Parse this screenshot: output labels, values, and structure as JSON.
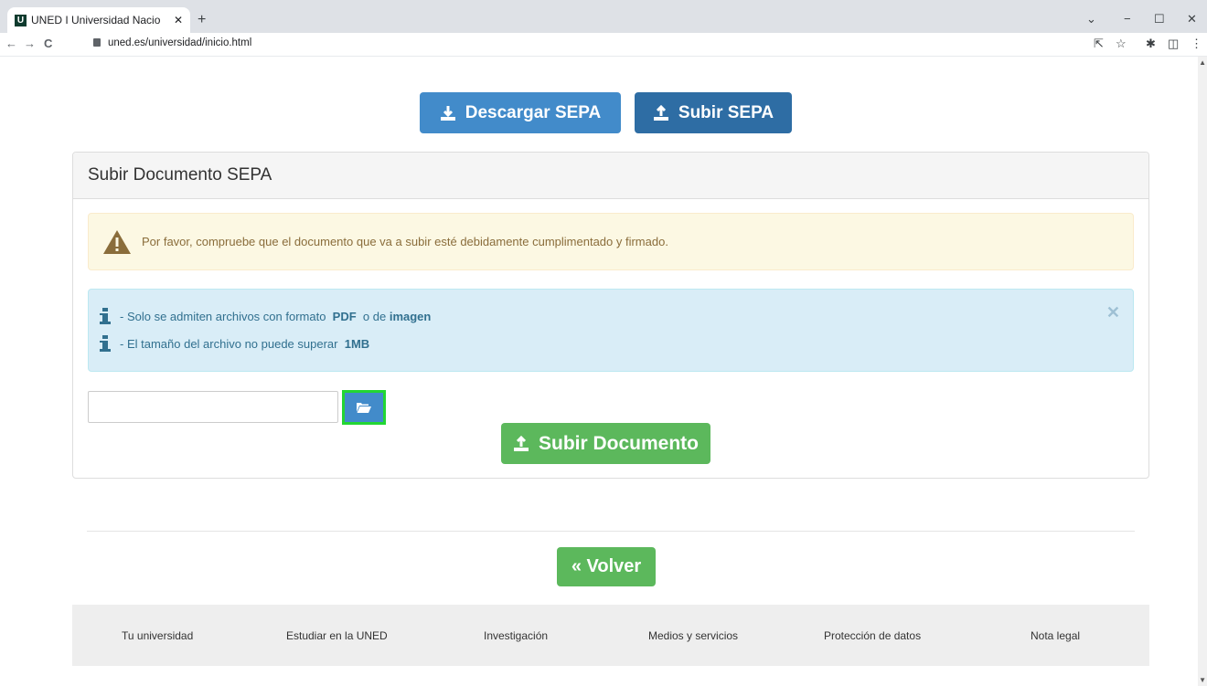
{
  "browser": {
    "tab_title": "UNED I Universidad Nacio",
    "favicon_letter": "U",
    "url": "uned.es/universidad/inicio.html",
    "new_tab": "+",
    "tab_close": "✕",
    "back": "←",
    "forward": "→",
    "reload": "C",
    "win_chevron": "⌄",
    "win_min": "−",
    "win_max": "☐",
    "win_close": "✕",
    "share_icon": "⇱",
    "star_icon": "☆",
    "ext_icon": "✱",
    "sidebar_icon": "◫",
    "menu_icon": "⋮"
  },
  "actions": {
    "descargar_label": "Descargar SEPA",
    "subir_label": "Subir SEPA"
  },
  "panel": {
    "heading": "Subir Documento SEPA",
    "warning_text": "Por favor, compruebe que el documento que va a subir esté debidamente cumplimentado y firmado.",
    "info": {
      "line1_prefix": "- Solo se admiten archivos con formato",
      "line1_pdf": "PDF",
      "line1_mid": "o de",
      "line1_img": "imagen",
      "line2_prefix": "- El tamaño del archivo no puede superar",
      "line2_size": "1MB",
      "close": "✕"
    },
    "file_value": "",
    "submit_label": "Subir Documento"
  },
  "back_label": "« Volver",
  "footer": {
    "links": [
      "Tu universidad",
      "Estudiar en la UNED",
      "Investigación",
      "Medios y servicios",
      "Protección de datos",
      "Nota legal"
    ]
  },
  "colors": {
    "primary": "#428bca",
    "primary_dark": "#2e6da4",
    "success": "#5cb85c",
    "focus_outline": "#22d633"
  }
}
